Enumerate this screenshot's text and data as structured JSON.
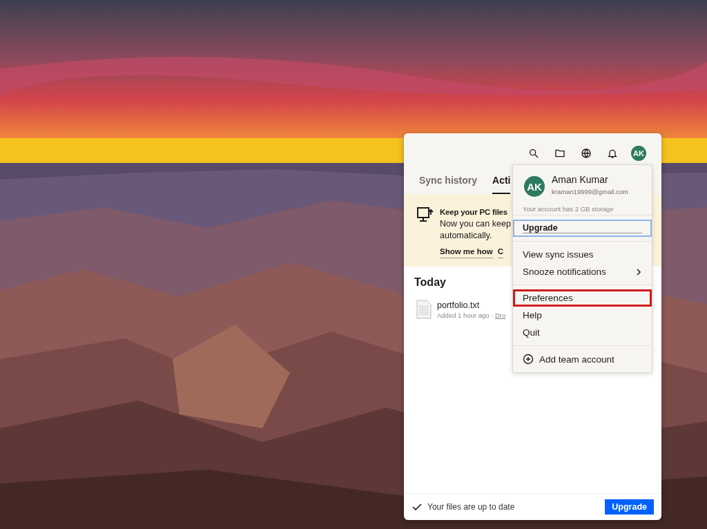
{
  "panel": {
    "toolbar": [
      {
        "kind": "search"
      },
      {
        "kind": "folder"
      },
      {
        "kind": "globe"
      },
      {
        "kind": "bell"
      },
      {
        "kind": "avatar",
        "label": "AK"
      }
    ],
    "tabs": [
      {
        "label": "Sync history",
        "selected": false
      },
      {
        "label": "Acti",
        "selected": true
      }
    ],
    "banner": {
      "title": "Keep your PC files",
      "body": [
        "Now you can keep",
        "automatically."
      ],
      "links": [
        "Show me how",
        "C"
      ]
    },
    "section": "Today",
    "files": [
      {
        "name": "portfolio.txt",
        "meta": "Added 1 hour ago · ",
        "link": "Dro"
      }
    ],
    "status": "Your files are up to date",
    "upgrade_button": "Upgrade"
  },
  "menu": {
    "avatar": "AK",
    "name": "Aman Kumar",
    "email": "kraman19999@gmail.com",
    "storage": "Your account has 2 GB storage",
    "groups": [
      [
        {
          "label": "Upgrade",
          "kind": "upgrade",
          "focused": true,
          "highlighted": false
        }
      ],
      [
        {
          "label": "View sync issues",
          "kind": "plain",
          "focused": false,
          "highlighted": false
        },
        {
          "label": "Snooze notifications",
          "kind": "submenu",
          "focused": false,
          "highlighted": false
        }
      ],
      [
        {
          "label": "Preferences",
          "kind": "plain",
          "focused": false,
          "highlighted": true
        },
        {
          "label": "Help",
          "kind": "plain",
          "focused": false,
          "highlighted": false
        },
        {
          "label": "Quit",
          "kind": "plain",
          "focused": false,
          "highlighted": false
        }
      ],
      [
        {
          "label": "Add team account",
          "kind": "add",
          "focused": false,
          "highlighted": false
        }
      ]
    ]
  }
}
